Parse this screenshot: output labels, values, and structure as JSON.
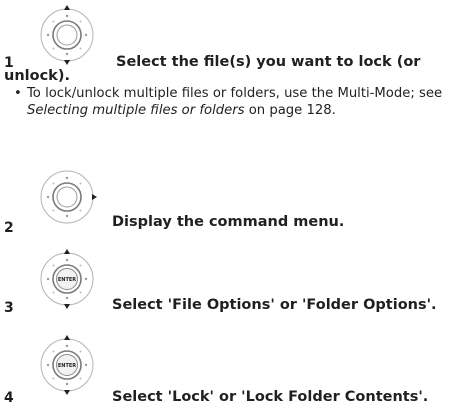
{
  "steps": [
    {
      "number": "1",
      "text_line1": "Select the file(s) you want to lock (or",
      "text_line2": "unlock).",
      "dial_icon": "dial-arrow-up-icon"
    },
    {
      "number": "2",
      "text": "Display the command menu.",
      "dial_icon": "dial-arrow-right-icon"
    },
    {
      "number": "3",
      "text": "Select 'File Options' or 'Folder Options'.",
      "dial_icon": "enter-dial-up-down-icon"
    },
    {
      "number": "4",
      "text": "Select 'Lock' or 'Lock Folder Contents'.",
      "dial_icon": "enter-dial-up-down-icon"
    }
  ],
  "note": {
    "bullet": "•",
    "before": "To lock/unlock multiple files or folders, use the Multi-Mode; see ",
    "link_italic": "Selecting multiple files or folders",
    "after": " on page 128."
  },
  "enter_label": "ENTER"
}
